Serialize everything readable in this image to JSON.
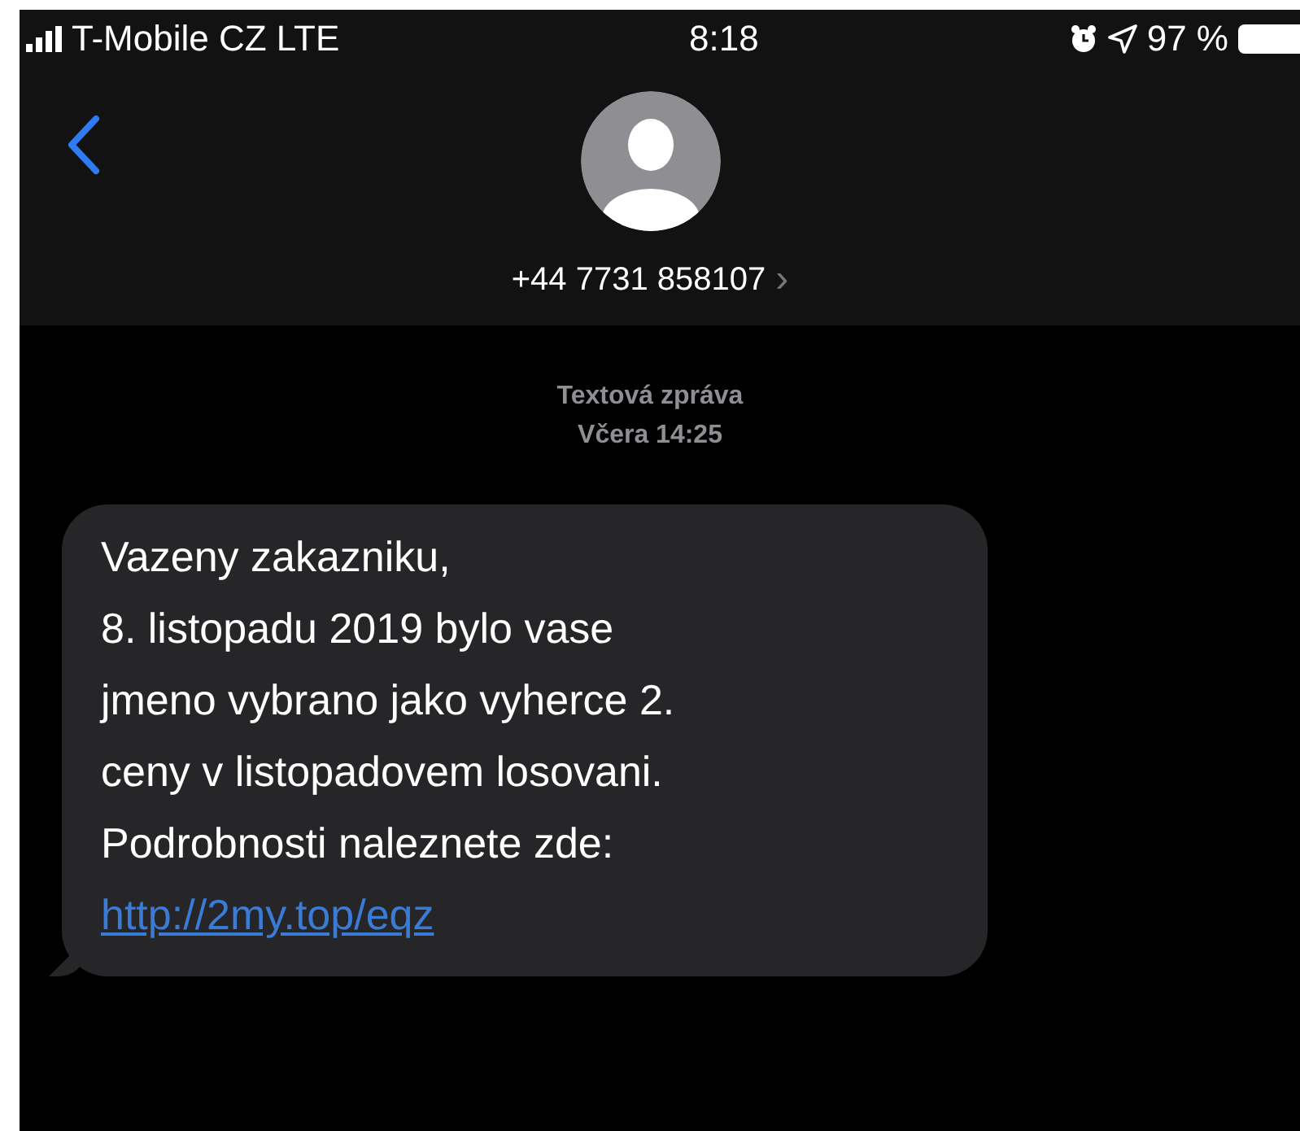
{
  "status_bar": {
    "carrier": "T-Mobile CZ LTE",
    "time": "8:18",
    "battery_percent": "97 %"
  },
  "header": {
    "contact": "+44 7731 858107",
    "chevron": "›"
  },
  "thread": {
    "service": "Textová zpráva",
    "timestamp": "Včera 14:25",
    "messages": [
      {
        "kind": "incoming",
        "text": "Vazeny zakazniku,\n8. listopadu 2019 bylo vase\njmeno vybrano jako vyherce 2.\nceny v listopadovem losovani.\nPodrobnosti naleznete zde:",
        "link": "http://2my.top/eqz"
      }
    ]
  }
}
